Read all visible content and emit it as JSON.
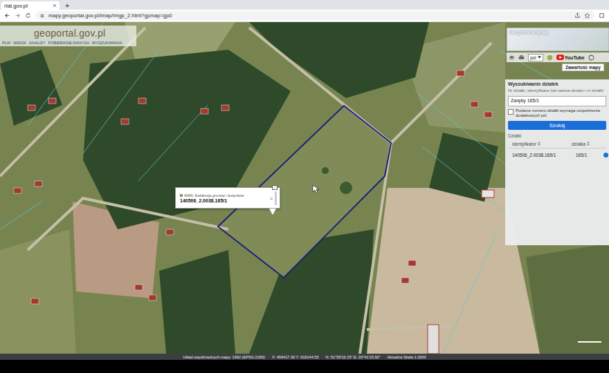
{
  "browser": {
    "tab_title": "rtal.gov.pl",
    "new_tab": "+",
    "url": "mapy.geoportal.gov.pl/imap/Imgp_2.html?gpmap=gp0"
  },
  "logo": "geoportal.gov.pl",
  "menu": [
    "PLIK",
    "WIDOK",
    "ANALIZY",
    "POBIERANIE DANYCH",
    "WYSZUKIWANIA"
  ],
  "overview": {
    "title": "Geoportal krajowy"
  },
  "toolbar": {
    "language": "pol",
    "youtube": "YouTube",
    "contents_button": "Zawartość mapy"
  },
  "popup": {
    "layer": "WMS: Ewidencja gruntów i budynków",
    "parcel_id": "140506_2.0038.165/1",
    "next": ">"
  },
  "search_panel": {
    "title": "Wyszukiwanie działek",
    "hint": "Nr działki, identyfikator lub nazwa obrębu i nr działki",
    "query": "Zaręby 165/1",
    "extra_fields": {
      "label": "Podanie numeru działki wymaga uzupełnienia dodatkowych pól",
      "checked": false
    },
    "button": "Szukaj",
    "results_title": "Działki",
    "columns": [
      "identyfikator",
      "działka"
    ],
    "rows": [
      {
        "identyfikator": "140506_2.0038.165/1",
        "dzialka": "165/1",
        "selected": false
      }
    ]
  },
  "status_bar": {
    "crs": "Układ współrzędnych mapy: 1992 (EPSG:2180)",
    "xy": "X: 459417.30 Y: 618144.55",
    "latlon": "N: 51°59'16.25\" E: 20°41'15.92\"",
    "scale": "Aktualna Skala 1:2000"
  }
}
